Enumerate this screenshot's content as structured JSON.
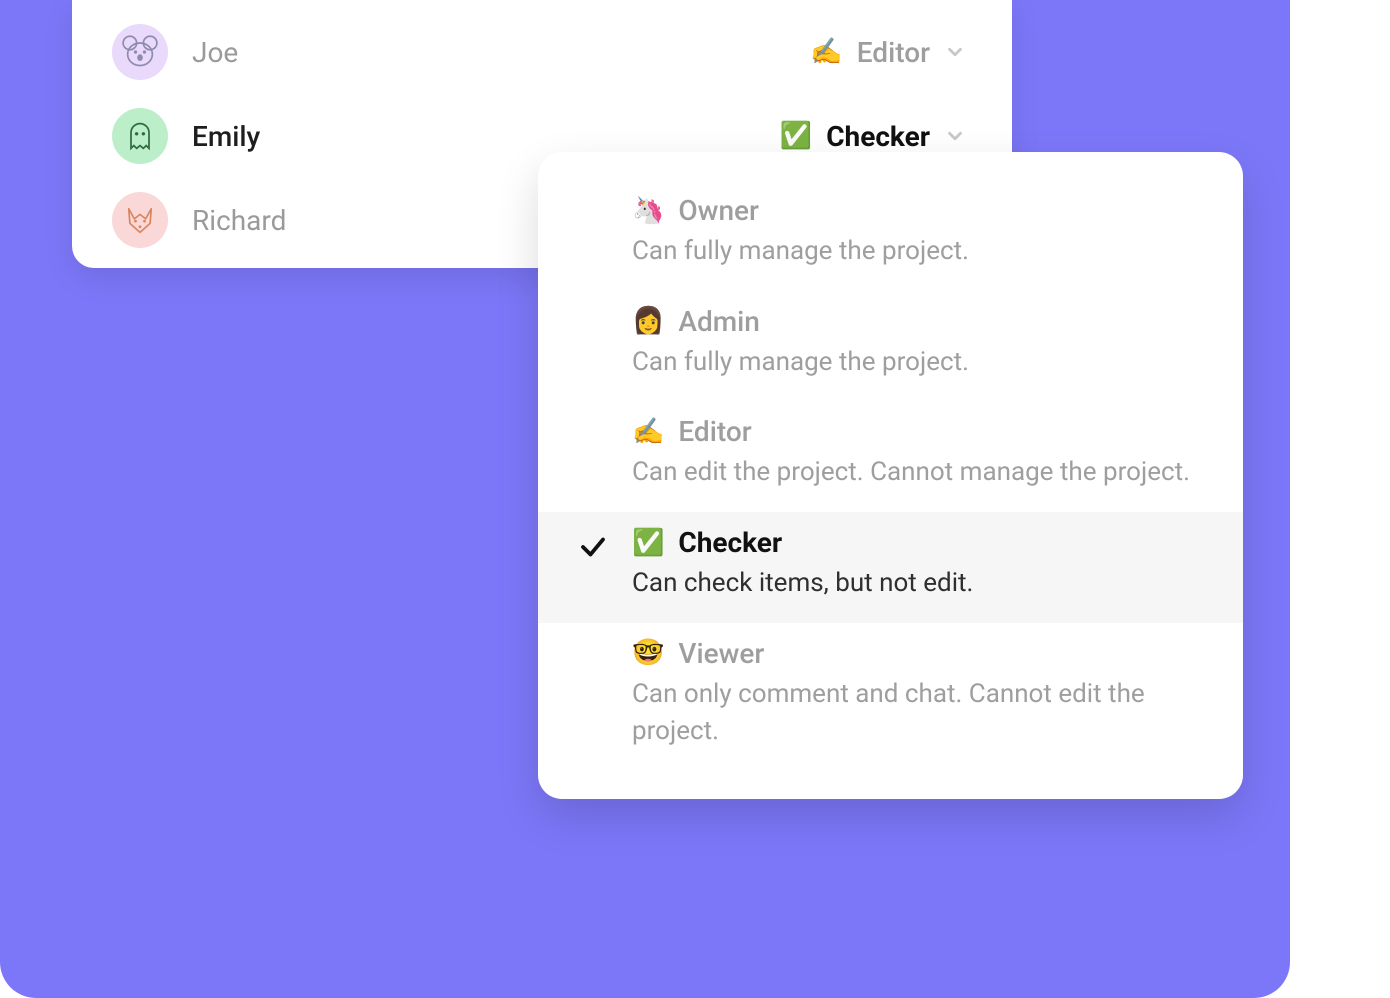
{
  "members": [
    {
      "name": "Joe",
      "role_emoji": "✍️",
      "role_label": "Editor",
      "muted": true,
      "avatar": "koala"
    },
    {
      "name": "Emily",
      "role_emoji": "✅",
      "role_label": "Checker",
      "muted": false,
      "avatar": "ghost"
    },
    {
      "name": "Richard",
      "role_emoji": "",
      "role_label": "",
      "muted": true,
      "avatar": "fox"
    }
  ],
  "role_options": [
    {
      "emoji": "🦄",
      "label": "Owner",
      "desc": "Can fully manage the project.",
      "selected": false
    },
    {
      "emoji": "👩",
      "label": "Admin",
      "desc": "Can fully manage the project.",
      "selected": false
    },
    {
      "emoji": "✍️",
      "label": "Editor",
      "desc": "Can edit the project. Cannot manage the project.",
      "selected": false
    },
    {
      "emoji": "✅",
      "label": "Checker",
      "desc": "Can check items, but not edit.",
      "selected": true
    },
    {
      "emoji": "🤓",
      "label": "Viewer",
      "desc": "Can only comment and chat. Cannot edit the project.",
      "selected": false
    }
  ]
}
